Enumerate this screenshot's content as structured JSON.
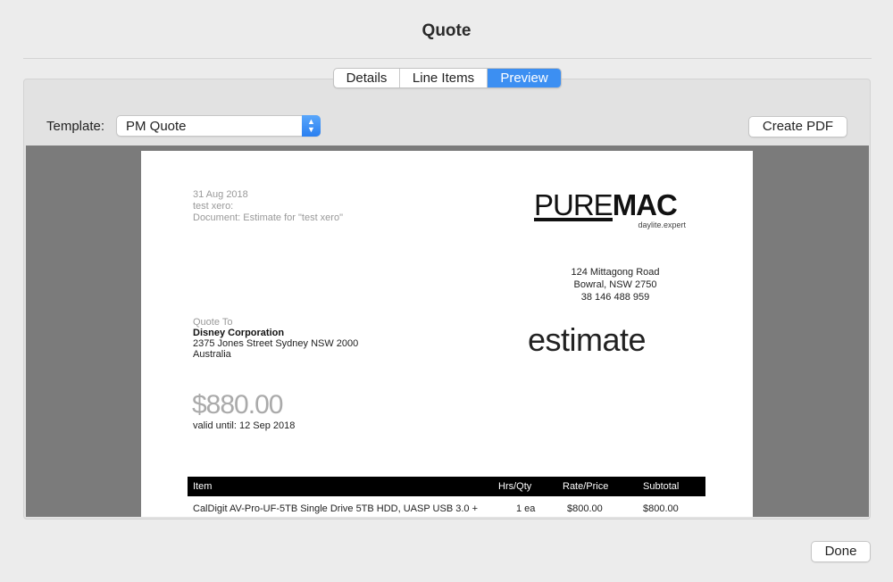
{
  "window": {
    "title": "Quote"
  },
  "tabs": [
    {
      "label": "Details",
      "active": false
    },
    {
      "label": "Line Items",
      "active": false
    },
    {
      "label": "Preview",
      "active": true
    }
  ],
  "template": {
    "label": "Template:",
    "selected": "PM Quote"
  },
  "buttons": {
    "create_pdf": "Create PDF",
    "done": "Done"
  },
  "document": {
    "date": "31 Aug 2018",
    "contact": "test xero:",
    "doc_line": "Document: Estimate for \"test xero\"",
    "logo": {
      "pure": "PURE",
      "mac": "MAC",
      "tagline": "daylite.expert"
    },
    "address": [
      "124 Mittagong Road",
      "Bowral, NSW 2750",
      "38 146 488 959"
    ],
    "quote_to_label": "Quote To",
    "client_name": "Disney Corporation",
    "client_address": "2375 Jones Street Sydney NSW 2000",
    "client_country": "Australia",
    "doc_type": "estimate",
    "amount": "$880.00",
    "valid_until": "valid until: 12 Sep 2018",
    "table": {
      "headers": [
        "Item",
        "Hrs/Qty",
        "Rate/Price",
        "Subtotal"
      ],
      "rows": [
        [
          "CalDigit AV-Pro-UF-5TB Single Drive 5TB HDD, UASP USB 3.0 +",
          "1 ea",
          "$800.00",
          "$800.00"
        ]
      ]
    }
  },
  "colors": {
    "accent": "#3c8ff2",
    "preview_bg": "#7b7b7b",
    "window_bg": "#ececec"
  }
}
